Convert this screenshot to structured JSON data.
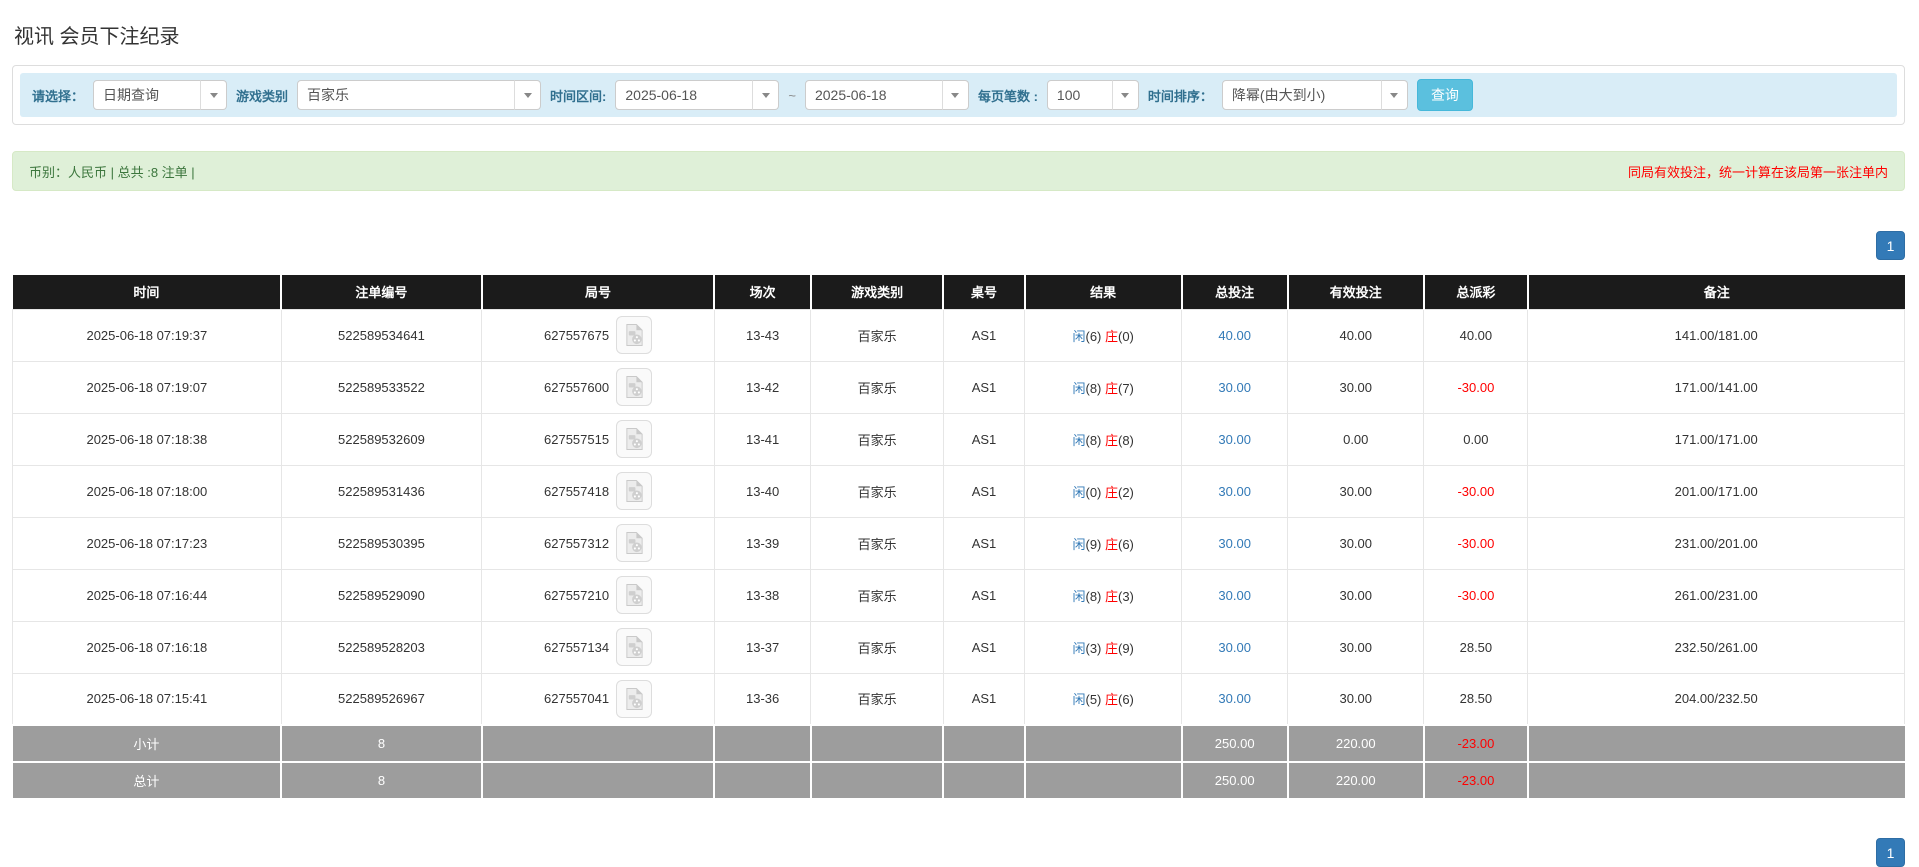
{
  "page": {
    "title": "视讯 会员下注纪录"
  },
  "filters": {
    "select_label": "请选择：",
    "select_value": "日期查询",
    "game_label": "游戏类别",
    "game_value": "百家乐",
    "range_label": "时间区间:",
    "date_from": "2025-06-18",
    "tilde": "~",
    "date_to": "2025-06-18",
    "per_page_label": "每页笔数 :",
    "per_page_value": "100",
    "sort_label": "时间排序：",
    "sort_value": "降幂(由大到小)",
    "search_button": "查询"
  },
  "summary": {
    "left": "币别：人民币 | 总共 :8 注单 |",
    "note": "同局有效投注，统一计算在该局第一张注单内"
  },
  "pagination": {
    "page": "1"
  },
  "icons": {
    "combo_arrow": "caret-down",
    "round_icon": "video-record-icon"
  },
  "colors": {
    "header_bg": "#1b1b1b",
    "filter_bg": "#d9edf7",
    "filter_label": "#31708f",
    "summary_bg": "#dff0d8",
    "summary_text": "#3c763d",
    "note_red": "#ff0000",
    "link_blue": "#337ab7",
    "search_btn": "#5bc0de",
    "pager_blue": "#337ab7",
    "sum_row_bg": "#9d9d9d",
    "negative": "#ff0000"
  },
  "table": {
    "headers": [
      "时间",
      "注单编号",
      "局号",
      "场次",
      "游戏类别",
      "桌号",
      "结果",
      "总投注",
      "有效投注",
      "总派彩",
      "备注"
    ],
    "rows": [
      {
        "time": "2025-06-18 07:19:37",
        "bet_id": "522589534641",
        "round": "627557675",
        "session": "13-43",
        "game": "百家乐",
        "table_no": "AS1",
        "player": "闲(6)",
        "banker": "庄(0)",
        "total_bet": "40.00",
        "valid_bet": "40.00",
        "payout": "40.00",
        "remark": "141.00/181.00"
      },
      {
        "time": "2025-06-18 07:19:07",
        "bet_id": "522589533522",
        "round": "627557600",
        "session": "13-42",
        "game": "百家乐",
        "table_no": "AS1",
        "player": "闲(8)",
        "banker": "庄(7)",
        "total_bet": "30.00",
        "valid_bet": "30.00",
        "payout": "-30.00",
        "remark": "171.00/141.00"
      },
      {
        "time": "2025-06-18 07:18:38",
        "bet_id": "522589532609",
        "round": "627557515",
        "session": "13-41",
        "game": "百家乐",
        "table_no": "AS1",
        "player": "闲(8)",
        "banker": "庄(8)",
        "total_bet": "30.00",
        "valid_bet": "0.00",
        "payout": "0.00",
        "remark": "171.00/171.00"
      },
      {
        "time": "2025-06-18 07:18:00",
        "bet_id": "522589531436",
        "round": "627557418",
        "session": "13-40",
        "game": "百家乐",
        "table_no": "AS1",
        "player": "闲(0)",
        "banker": "庄(2)",
        "total_bet": "30.00",
        "valid_bet": "30.00",
        "payout": "-30.00",
        "remark": "201.00/171.00"
      },
      {
        "time": "2025-06-18 07:17:23",
        "bet_id": "522589530395",
        "round": "627557312",
        "session": "13-39",
        "game": "百家乐",
        "table_no": "AS1",
        "player": "闲(9)",
        "banker": "庄(6)",
        "total_bet": "30.00",
        "valid_bet": "30.00",
        "payout": "-30.00",
        "remark": "231.00/201.00"
      },
      {
        "time": "2025-06-18 07:16:44",
        "bet_id": "522589529090",
        "round": "627557210",
        "session": "13-38",
        "game": "百家乐",
        "table_no": "AS1",
        "player": "闲(8)",
        "banker": "庄(3)",
        "total_bet": "30.00",
        "valid_bet": "30.00",
        "payout": "-30.00",
        "remark": "261.00/231.00"
      },
      {
        "time": "2025-06-18 07:16:18",
        "bet_id": "522589528203",
        "round": "627557134",
        "session": "13-37",
        "game": "百家乐",
        "table_no": "AS1",
        "player": "闲(3)",
        "banker": "庄(9)",
        "total_bet": "30.00",
        "valid_bet": "30.00",
        "payout": "28.50",
        "remark": "232.50/261.00"
      },
      {
        "time": "2025-06-18 07:15:41",
        "bet_id": "522589526967",
        "round": "627557041",
        "session": "13-36",
        "game": "百家乐",
        "table_no": "AS1",
        "player": "闲(5)",
        "banker": "庄(6)",
        "total_bet": "30.00",
        "valid_bet": "30.00",
        "payout": "28.50",
        "remark": "204.00/232.50"
      }
    ],
    "subtotal": {
      "label": "小计",
      "count": "8",
      "total_bet": "250.00",
      "valid_bet": "220.00",
      "payout": "-23.00"
    },
    "total": {
      "label": "总计",
      "count": "8",
      "total_bet": "250.00",
      "valid_bet": "220.00",
      "payout": "-23.00"
    }
  }
}
